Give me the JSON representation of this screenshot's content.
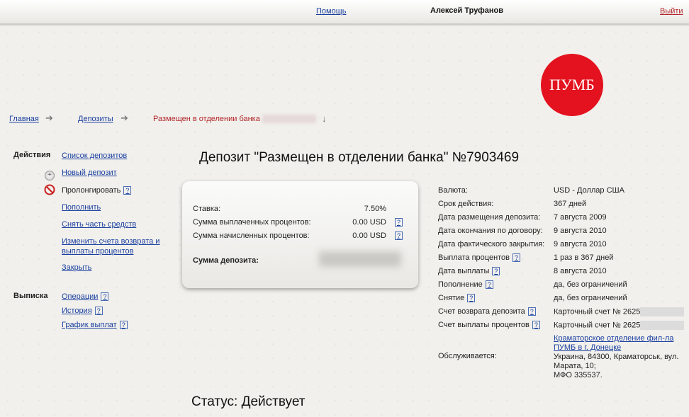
{
  "topbar": {
    "help": "Помощь",
    "user": "Алексей Труфанов",
    "logout": "Выйти"
  },
  "logo": {
    "text": "ПУМБ",
    "color": "#e3121e"
  },
  "breadcrumb": {
    "home": "Главная",
    "deposits": "Депозиты",
    "current": "Размещен в отделении банка"
  },
  "sidebar": {
    "actions_title": "Действия",
    "actions": {
      "list": "Список депозитов",
      "new": "Новый депозит",
      "prolong": "Пролонгировать",
      "topup": "Пополнить",
      "withdraw": "Снять часть средств",
      "change_accounts": "Изменить счета возврата и выплаты процентов",
      "close": "Закрыть"
    },
    "statement_title": "Выписка",
    "statement": {
      "operations": "Операции",
      "history": "История",
      "schedule": "График выплат"
    },
    "help_mark": "?"
  },
  "deposit": {
    "title": "Депозит \"Размещен в отделении банка\" №7903469",
    "rate_label": "Ставка:",
    "rate_value": "7.50%",
    "paid_label": "Сумма выплаченных процентов:",
    "paid_value": "0.00 USD",
    "accrued_label": "Сумма начисленных процентов:",
    "accrued_value": "0.00 USD",
    "sum_label": "Сумма депозита:"
  },
  "details": {
    "currency_label": "Валюта:",
    "currency_value": "USD - Доллар США",
    "term_label": "Срок действия:",
    "term_value": "367 дней",
    "placed_label": "Дата размещения депозита:",
    "placed_value": "7 августа 2009",
    "end_label": "Дата окончания по договору:",
    "end_value": "9 августа 2010",
    "closed_label": "Дата фактического закрытия:",
    "closed_value": "9 августа 2010",
    "payout_label": "Выплата процентов",
    "payout_value": "1 раз в 367 дней",
    "payout_date_label": "Дата выплаты",
    "payout_date_value": "8 августа 2010",
    "topup_label": "Пополнение",
    "topup_value": "да, без ограничений",
    "withdraw_label": "Снятие",
    "withdraw_value": "да, без ограничений",
    "return_acc_label": "Счет возврата депозита",
    "return_acc_value": "Карточный счет № 2625",
    "interest_acc_label": "Счет выплаты процентов",
    "interest_acc_value": "Карточный счет № 2625",
    "served_label": "Обслуживается:",
    "branch_link": "Краматорское отделение фил-ла ПУМБ в г. Донецке",
    "address": "Украина, 84300, Краматорськ, вул. Марата, 10;",
    "mfo": "МФО 335537."
  },
  "status": "Статус: Действует"
}
